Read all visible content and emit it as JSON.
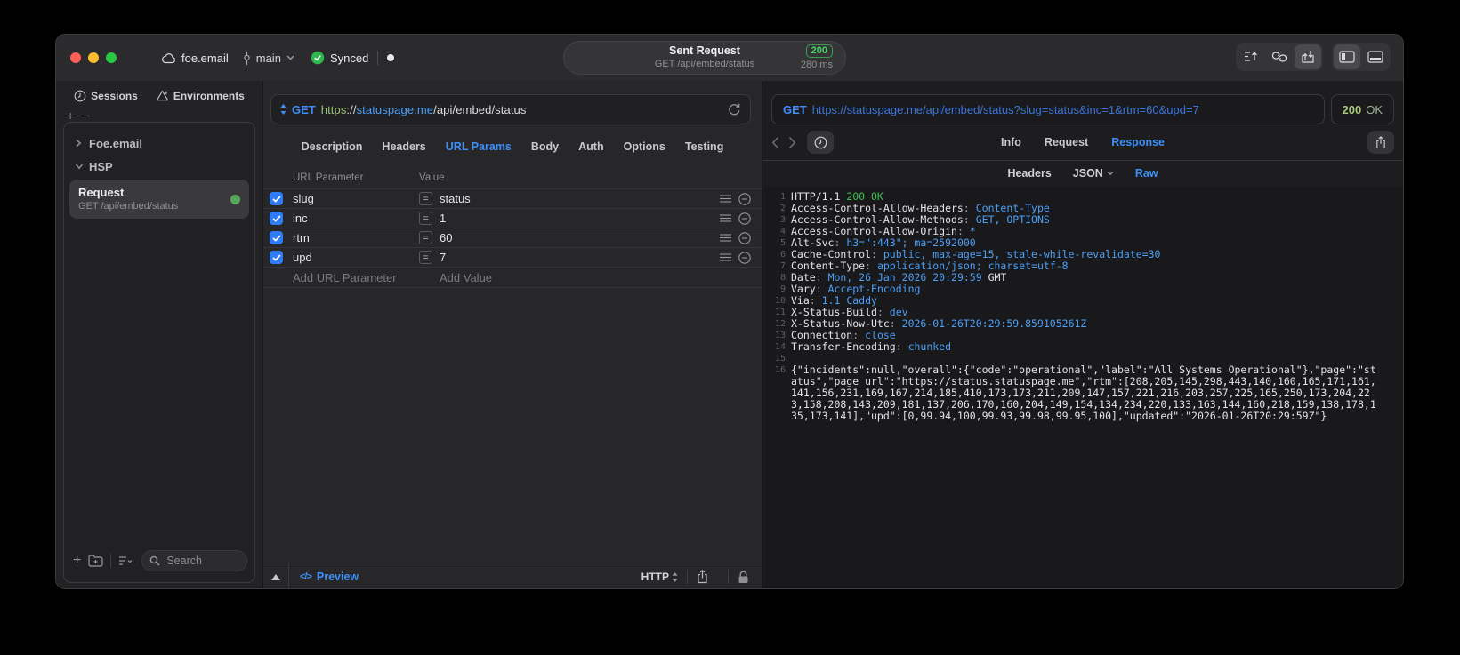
{
  "titlebar": {
    "project": "foe.email",
    "branch": "main",
    "sync_label": "Synced",
    "request_summary": {
      "title": "Sent Request",
      "status_code": "200",
      "method_path": "GET /api/embed/status",
      "duration": "280 ms"
    }
  },
  "sidebar": {
    "tabs": [
      {
        "id": "sessions",
        "label": "Sessions"
      },
      {
        "id": "environments",
        "label": "Environments"
      }
    ],
    "tree": [
      {
        "type": "group",
        "label": "Foe.email",
        "expanded": false
      },
      {
        "type": "group",
        "label": "HSP",
        "expanded": true
      },
      {
        "type": "request",
        "title": "Request",
        "subtitle": "GET /api/embed/status",
        "selected": true,
        "status_color": "#57a85c"
      }
    ],
    "search_placeholder": "Search"
  },
  "request_editor": {
    "method": "GET",
    "url_segments": [
      {
        "t": "https",
        "color": "#9cc177"
      },
      {
        "t": "://",
        "color": "#dadadc"
      },
      {
        "t": "statuspage.me",
        "color": "#4d9ff6"
      },
      {
        "t": "/api/embed/status",
        "color": "#dadadc"
      }
    ],
    "tabs": [
      "Description",
      "Headers",
      "URL Params",
      "Body",
      "Auth",
      "Options",
      "Testing"
    ],
    "active_tab": "URL Params",
    "table": {
      "columns": [
        "URL Parameter",
        "Value"
      ],
      "rows": [
        {
          "enabled": true,
          "name": "slug",
          "value": "status"
        },
        {
          "enabled": true,
          "name": "inc",
          "value": "1"
        },
        {
          "enabled": true,
          "name": "rtm",
          "value": "60"
        },
        {
          "enabled": true,
          "name": "upd",
          "value": "7"
        }
      ],
      "add_name_placeholder": "Add URL Parameter",
      "add_value_placeholder": "Add Value"
    },
    "footer": {
      "preview_label": "Preview",
      "code_glyph": "</>",
      "protocol_selector": "HTTP"
    }
  },
  "response_viewer": {
    "request_line": {
      "method": "GET",
      "url": "https://statuspage.me/api/embed/status?slug=status&inc=1&rtm=60&upd=7"
    },
    "status_code": "200",
    "status_text": "OK",
    "tabs": [
      "Info",
      "Request",
      "Response"
    ],
    "active_tab": "Response",
    "subtabs": [
      {
        "label": "Headers",
        "dropdown": false
      },
      {
        "label": "JSON",
        "dropdown": true
      },
      {
        "label": "Raw",
        "dropdown": false
      }
    ],
    "active_subtab": "Raw",
    "body_lines": [
      {
        "n": "1",
        "segs": [
          {
            "t": "HTTP/1.1 ",
            "c": "w"
          },
          {
            "t": "200 OK",
            "c": "g"
          }
        ]
      },
      {
        "n": "2",
        "segs": [
          {
            "t": "Access-Control-Allow-Headers",
            "c": "w"
          },
          {
            "t": ": ",
            "c": "d"
          },
          {
            "t": "Content-Type",
            "c": "b"
          }
        ]
      },
      {
        "n": "3",
        "segs": [
          {
            "t": "Access-Control-Allow-Methods",
            "c": "w"
          },
          {
            "t": ": ",
            "c": "d"
          },
          {
            "t": "GET, OPTIONS",
            "c": "b"
          }
        ]
      },
      {
        "n": "4",
        "segs": [
          {
            "t": "Access-Control-Allow-Origin",
            "c": "w"
          },
          {
            "t": ": ",
            "c": "d"
          },
          {
            "t": "*",
            "c": "b"
          }
        ]
      },
      {
        "n": "5",
        "segs": [
          {
            "t": "Alt-Svc",
            "c": "w"
          },
          {
            "t": ": ",
            "c": "d"
          },
          {
            "t": "h3=\":443\"; ma=2592000",
            "c": "b"
          }
        ]
      },
      {
        "n": "6",
        "segs": [
          {
            "t": "Cache-Control",
            "c": "w"
          },
          {
            "t": ": ",
            "c": "d"
          },
          {
            "t": "public, max-age=15, stale-while-revalidate=30",
            "c": "b"
          }
        ]
      },
      {
        "n": "7",
        "segs": [
          {
            "t": "Content-Type",
            "c": "w"
          },
          {
            "t": ": ",
            "c": "d"
          },
          {
            "t": "application/json; charset=utf-8",
            "c": "b"
          }
        ]
      },
      {
        "n": "8",
        "segs": [
          {
            "t": "Date",
            "c": "w"
          },
          {
            "t": ": ",
            "c": "d"
          },
          {
            "t": "Mon, 26 Jan 2026 20:29:59",
            "c": "b"
          },
          {
            "t": " GMT",
            "c": "w"
          }
        ]
      },
      {
        "n": "9",
        "segs": [
          {
            "t": "Vary",
            "c": "w"
          },
          {
            "t": ": ",
            "c": "d"
          },
          {
            "t": "Accept-Encoding",
            "c": "b"
          }
        ]
      },
      {
        "n": "10",
        "segs": [
          {
            "t": "Via",
            "c": "w"
          },
          {
            "t": ": ",
            "c": "d"
          },
          {
            "t": "1.1 Caddy",
            "c": "b"
          }
        ]
      },
      {
        "n": "11",
        "segs": [
          {
            "t": "X-Status-Build",
            "c": "w"
          },
          {
            "t": ": ",
            "c": "d"
          },
          {
            "t": "dev",
            "c": "b"
          }
        ]
      },
      {
        "n": "12",
        "segs": [
          {
            "t": "X-Status-Now-Utc",
            "c": "w"
          },
          {
            "t": ": ",
            "c": "d"
          },
          {
            "t": "2026-01-26T20:29:59.859105261Z",
            "c": "b"
          }
        ]
      },
      {
        "n": "13",
        "segs": [
          {
            "t": "Connection",
            "c": "w"
          },
          {
            "t": ": ",
            "c": "d"
          },
          {
            "t": "close",
            "c": "b"
          }
        ]
      },
      {
        "n": "14",
        "segs": [
          {
            "t": "Transfer-Encoding",
            "c": "w"
          },
          {
            "t": ": ",
            "c": "d"
          },
          {
            "t": "chunked",
            "c": "b"
          }
        ]
      },
      {
        "n": "15",
        "segs": []
      },
      {
        "n": "16",
        "segs": [
          {
            "t": "{\"incidents\":null,\"overall\":{\"code\":\"operational\",\"label\":\"All Systems Operational\"},\"page\":\"status\",\"page_url\":\"https://status.statuspage.me\",\"rtm\":[208,205,145,298,443,140,160,165,171,161,141,156,231,169,167,214,185,410,173,173,211,209,147,157,221,216,203,257,225,165,250,173,204,223,158,208,143,209,181,137,206,170,160,204,149,154,134,234,220,133,163,144,160,218,159,138,178,135,173,141],\"upd\":[0,99.94,100,99.93,99.98,99.95,100],\"updated\":\"2026-01-26T20:29:59Z\"}",
            "c": "w"
          }
        ]
      }
    ]
  },
  "colors": {
    "accent_blue": "#3e8ff7",
    "value_blue": "#4d9ff6",
    "status_green": "#3ed563",
    "muted_green": "#a7c97c",
    "checkbox_blue": "#2f7cf6"
  }
}
